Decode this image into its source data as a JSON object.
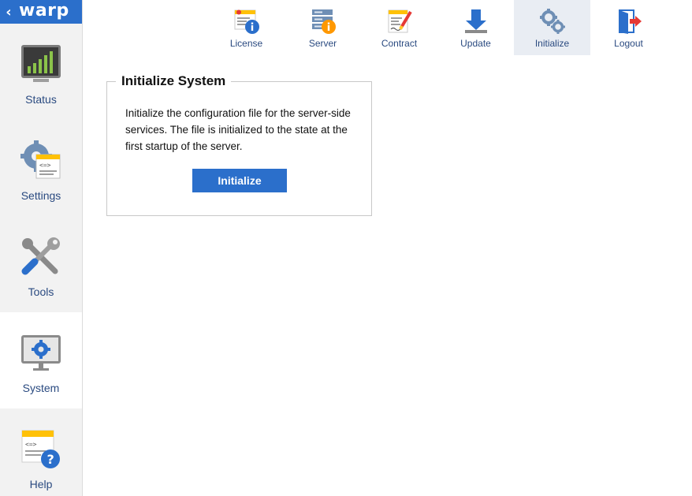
{
  "brand": {
    "back_glyph": "‹",
    "name": "warp"
  },
  "sidebar": {
    "items": [
      {
        "label": "Status",
        "icon": "status-chart-icon"
      },
      {
        "label": "Settings",
        "icon": "settings-gear-icon"
      },
      {
        "label": "Tools",
        "icon": "tools-wrench-icon"
      },
      {
        "label": "System",
        "icon": "system-monitor-icon",
        "active": true
      },
      {
        "label": "Help",
        "icon": "help-question-icon"
      }
    ]
  },
  "toolbar": {
    "items": [
      {
        "label": "License",
        "icon": "license-icon"
      },
      {
        "label": "Server",
        "icon": "server-icon"
      },
      {
        "label": "Contract",
        "icon": "contract-icon"
      },
      {
        "label": "Update",
        "icon": "update-download-icon"
      },
      {
        "label": "Initialize",
        "icon": "initialize-gears-icon",
        "active": true
      },
      {
        "label": "Logout",
        "icon": "logout-door-icon"
      }
    ]
  },
  "panel": {
    "title": "Initialize System",
    "description": "Initialize the configuration file for the server-side services. The file is initialized to the state at the first startup of the server.",
    "button_label": "Initialize"
  },
  "colors": {
    "accent": "#2b6fcb",
    "sidebar_bg": "#f2f2f2",
    "active_tab_bg": "#e9edf3",
    "label_text": "#2a4a80"
  }
}
